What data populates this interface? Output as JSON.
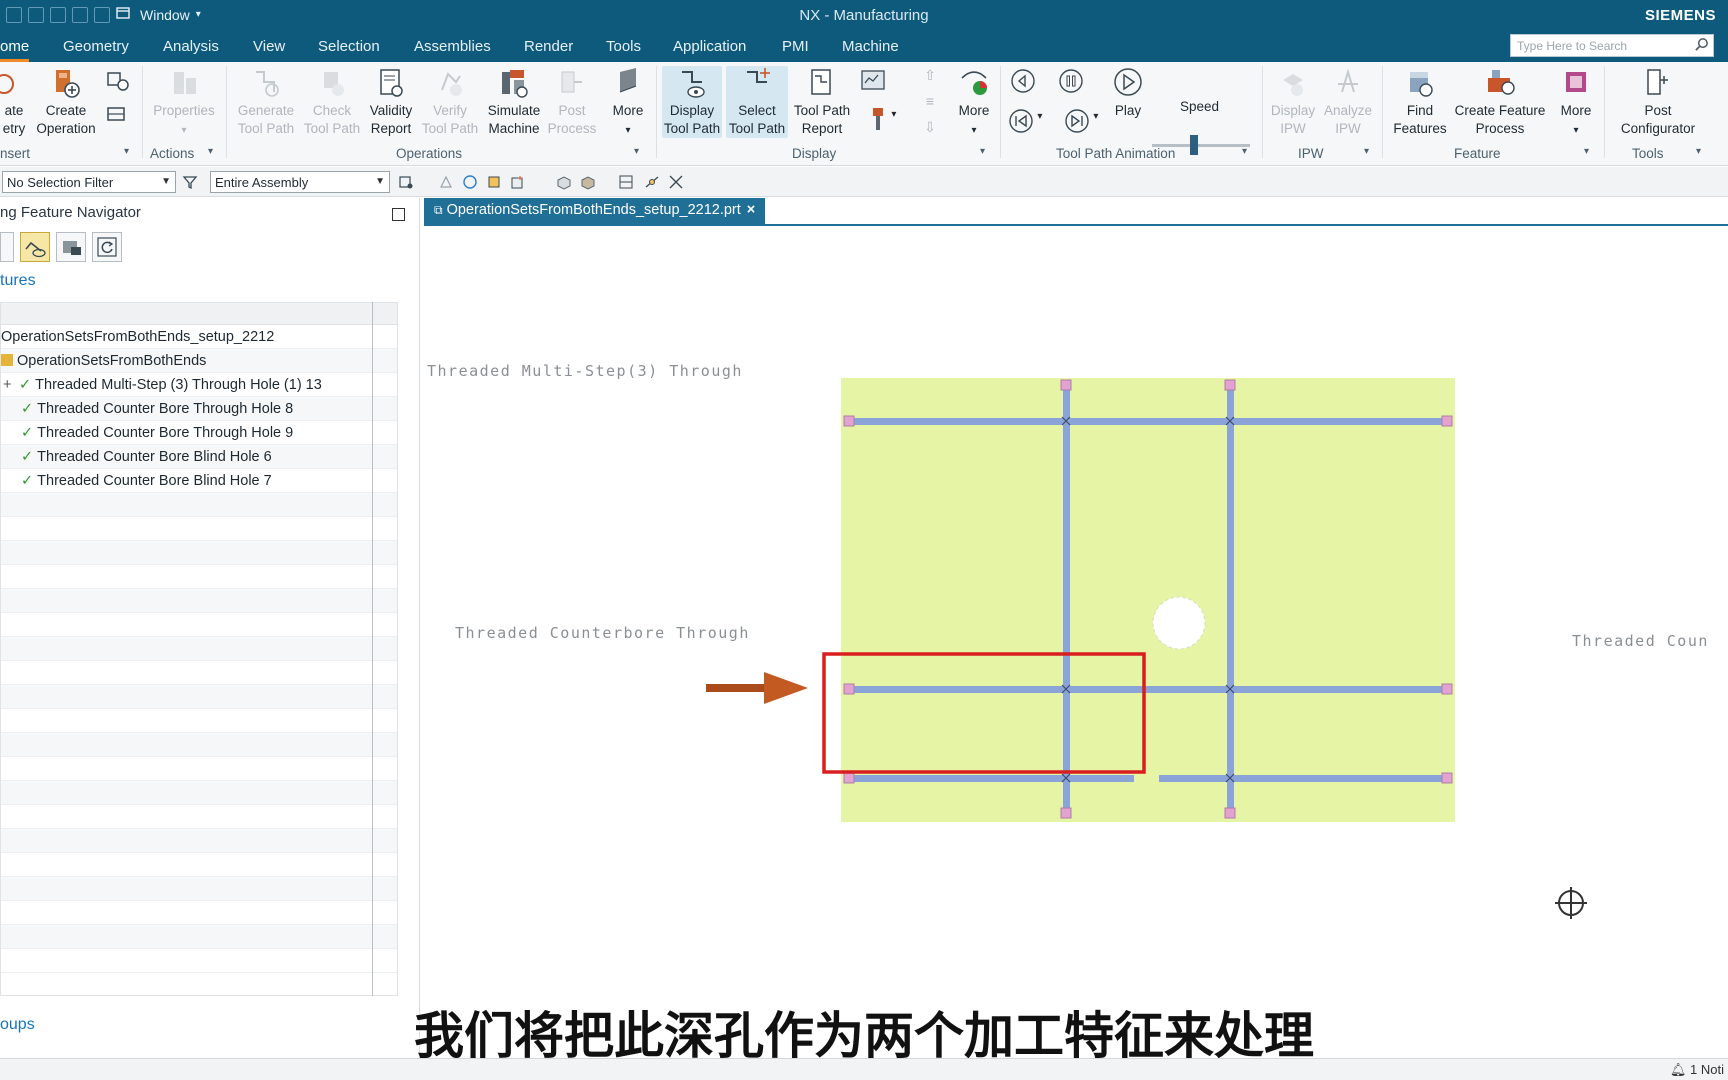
{
  "app": {
    "title": "NX - Manufacturing",
    "brand": "SIEMENS",
    "window_menu": "Window"
  },
  "menu": {
    "tabs": [
      "ome",
      "Geometry",
      "Analysis",
      "View",
      "Selection",
      "Assemblies",
      "Render",
      "Tools",
      "Application",
      "PMI",
      "Machine"
    ],
    "active_index": 0,
    "search_placeholder": "Type Here to Search"
  },
  "ribbon": {
    "buttons": {
      "create_geometry": "ate\netry",
      "create_operation": "Create\nOperation",
      "properties": "Properties",
      "generate_tool_path": "Generate\nTool Path",
      "check_tool_path": "Check\nTool Path",
      "validity_report": "Validity\nReport",
      "verify_tool_path": "Verify\nTool Path",
      "simulate_machine": "Simulate\nMachine",
      "post_process": "Post\nProcess",
      "more_ops": "More",
      "display_tool_path": "Display\nTool Path",
      "select_tool_path": "Select\nTool Path",
      "tool_path_report": "Tool Path\nReport",
      "more_display": "More",
      "play": "Play",
      "speed": "Speed",
      "display_ipw": "Display\nIPW",
      "analyze_ipw": "Analyze\nIPW",
      "find_features": "Find\nFeatures",
      "create_feature_process": "Create Feature\nProcess",
      "more_feature": "More",
      "post_configurator": "Post\nConfigurator"
    },
    "groups": {
      "insert": "nsert",
      "actions": "Actions",
      "operations": "Operations",
      "display": "Display",
      "tool_path_animation": "Tool Path Animation",
      "ipw": "IPW",
      "feature": "Feature",
      "tools": "Tools"
    }
  },
  "selection_bar": {
    "filter": "No Selection Filter",
    "scope": "Entire Assembly"
  },
  "navigator": {
    "title": "ng Feature Navigator",
    "section_features": "tures",
    "section_groups": "oups",
    "items": [
      {
        "label": "OperationSetsFromBothEnds_setup_2212",
        "kind": "root"
      },
      {
        "label": "OperationSetsFromBothEnds",
        "kind": "part"
      },
      {
        "label": "Threaded Multi-Step (3) Through Hole (1) 13",
        "kind": "feature",
        "expand": "+"
      },
      {
        "label": "Threaded Counter Bore Through Hole 8",
        "kind": "feature"
      },
      {
        "label": "Threaded Counter Bore Through Hole 9",
        "kind": "feature"
      },
      {
        "label": "Threaded Counter Bore Blind Hole 6",
        "kind": "feature"
      },
      {
        "label": "Threaded Counter Bore Blind Hole 7",
        "kind": "feature"
      }
    ]
  },
  "document": {
    "tab_label": "OperationSetsFromBothEnds_setup_2212.prt",
    "close": "×"
  },
  "graphics": {
    "annotations": {
      "multi_step": "Threaded Multi-Step(3) Through",
      "counterbore": "Threaded Counterbore Through",
      "right_cut": "Threaded Coun"
    },
    "colors": {
      "part_face": "#e6f5a5",
      "hole_axis": "#8aa4d8",
      "highlight_box": "#d81e1e",
      "arrow": "#a94b1a"
    }
  },
  "subtitle": "我们将把此深孔作为两个加工特征来处理",
  "status": {
    "notifications": "1 Noti"
  }
}
